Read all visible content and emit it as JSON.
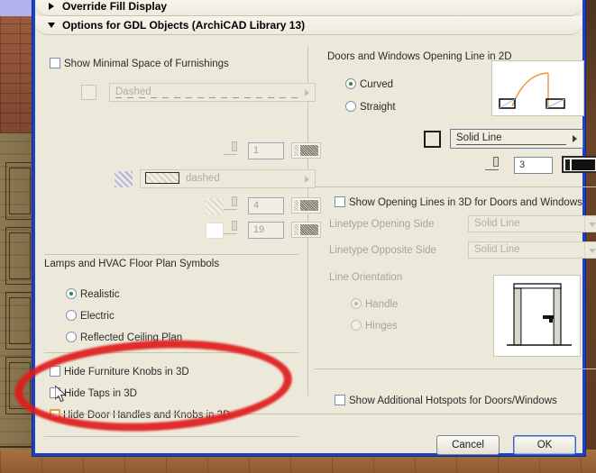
{
  "dialog": {
    "sections": [
      {
        "title": "Override Fill Display",
        "state": "collapsed",
        "icon": "triangle-right-icon"
      },
      {
        "title": "Options for GDL Objects (ArchiCAD Library 13)",
        "state": "expanded",
        "icon": "triangle-down-icon"
      }
    ]
  },
  "left": {
    "minimal_space_checkbox": {
      "label": "Show Minimal Space of Furnishings",
      "checked": false
    },
    "line_row": {
      "swatch_label": "",
      "linetype_value": "Dashed",
      "pen_weight": "1",
      "pen_color_label": ""
    },
    "fill_row": {
      "fill_value": "dashed",
      "fill_pen_weight": "4",
      "background_pen_weight": "19"
    },
    "lamps_group": {
      "title": "Lamps and HVAC Floor Plan Symbols",
      "options": [
        {
          "label": "Realistic",
          "selected": true
        },
        {
          "label": "Electric",
          "selected": false
        },
        {
          "label": "Reflected Ceiling Plan",
          "selected": false
        }
      ]
    },
    "hide_checkboxes": [
      {
        "label": "Hide Furniture Knobs in 3D",
        "checked": false,
        "highlighted": false
      },
      {
        "label": "Hide Taps in 3D",
        "checked": false,
        "highlighted": false
      },
      {
        "label": "Hide Door Handles and Knobs in 3D",
        "checked": false,
        "highlighted": true
      }
    ]
  },
  "right": {
    "opening_line_group": {
      "title": "Doors and Windows Opening Line in 2D",
      "options": [
        {
          "label": "Curved",
          "selected": true
        },
        {
          "label": "Straight",
          "selected": false
        }
      ],
      "preview": "door-swing-curved-preview"
    },
    "opening_line_style": {
      "linetype_value": "Solid Line",
      "pen_weight": "3",
      "pen_color_label": ""
    },
    "show_opening_lines_3d": {
      "label": "Show Opening Lines in 3D for Doors and Windows",
      "checked": false
    },
    "linetype_opening_side": {
      "label": "Linetype Opening Side",
      "value": "Solid Line",
      "enabled": false
    },
    "linetype_opposite_side": {
      "label": "Linetype Opposite Side",
      "value": "Solid Line",
      "enabled": false
    },
    "line_orientation": {
      "title": "Line Orientation",
      "options": [
        {
          "label": "Handle",
          "selected": true
        },
        {
          "label": "Hinges",
          "selected": false
        }
      ],
      "preview": "door-elevation-preview"
    },
    "show_additional_hotspots": {
      "label": "Show Additional Hotspots for Doors/Windows",
      "checked": false
    }
  },
  "footer": {
    "cancel_label": "Cancel",
    "ok_label": "OK"
  },
  "colors": {
    "dialog_border": "#1a41c8",
    "dialog_bg": "#ece9db",
    "radio_dot": "#2e8b2e",
    "annotation": "#e01c1c",
    "highlight_checkbox": "#e0a43c",
    "swing_arc": "#e89b3c"
  }
}
